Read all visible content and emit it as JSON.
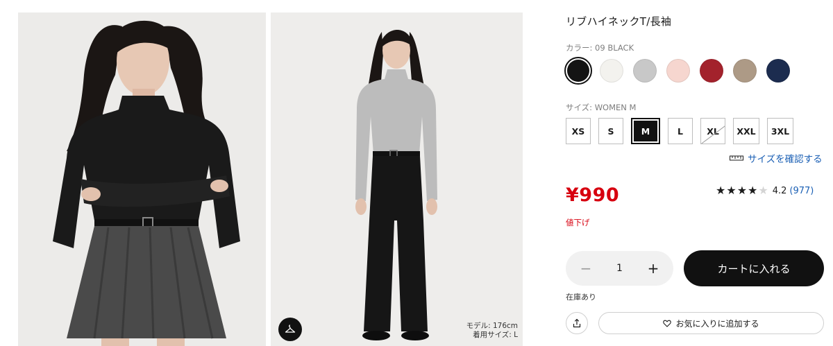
{
  "product": {
    "title": "リブハイネックT/長袖",
    "price": "¥990",
    "price_note": "値下げ",
    "stock_status": "在庫あり"
  },
  "color": {
    "label": "カラー: ",
    "selected": "09 BLACK",
    "swatches": [
      {
        "name": "black",
        "hex": "#141414",
        "selected": true
      },
      {
        "name": "off-white",
        "hex": "#f3f2ee",
        "selected": false
      },
      {
        "name": "gray",
        "hex": "#c8c8c8",
        "selected": false
      },
      {
        "name": "pink",
        "hex": "#f6d6cf",
        "selected": false
      },
      {
        "name": "wine",
        "hex": "#a3222c",
        "selected": false
      },
      {
        "name": "beige",
        "hex": "#ad9a86",
        "selected": false
      },
      {
        "name": "navy",
        "hex": "#1c2c4f",
        "selected": false
      }
    ]
  },
  "size": {
    "label": "サイズ: ",
    "selected": "WOMEN M",
    "options": [
      {
        "label": "XS",
        "selected": false,
        "available": true
      },
      {
        "label": "S",
        "selected": false,
        "available": true
      },
      {
        "label": "M",
        "selected": true,
        "available": true
      },
      {
        "label": "L",
        "selected": false,
        "available": true
      },
      {
        "label": "XL",
        "selected": false,
        "available": false
      },
      {
        "label": "XXL",
        "selected": false,
        "available": true
      },
      {
        "label": "3XL",
        "selected": false,
        "available": true
      }
    ],
    "guide_link": "サイズを確認する"
  },
  "rating": {
    "value": "4.2",
    "count": "(977)",
    "stars_filled": 4,
    "stars_total": 5
  },
  "quantity": {
    "value": "1",
    "minus": "−",
    "plus": "+"
  },
  "actions": {
    "add_to_cart": "カートに入れる",
    "favorite": "お気に入りに追加する"
  },
  "gallery": {
    "model_info_line1": "モデル: 176cm",
    "model_info_line2": "着用サイズ: L"
  },
  "icons": {
    "outfit": "hanger-icon",
    "share": "share-icon",
    "favorite": "heart-icon",
    "size_guide": "ruler-icon"
  }
}
